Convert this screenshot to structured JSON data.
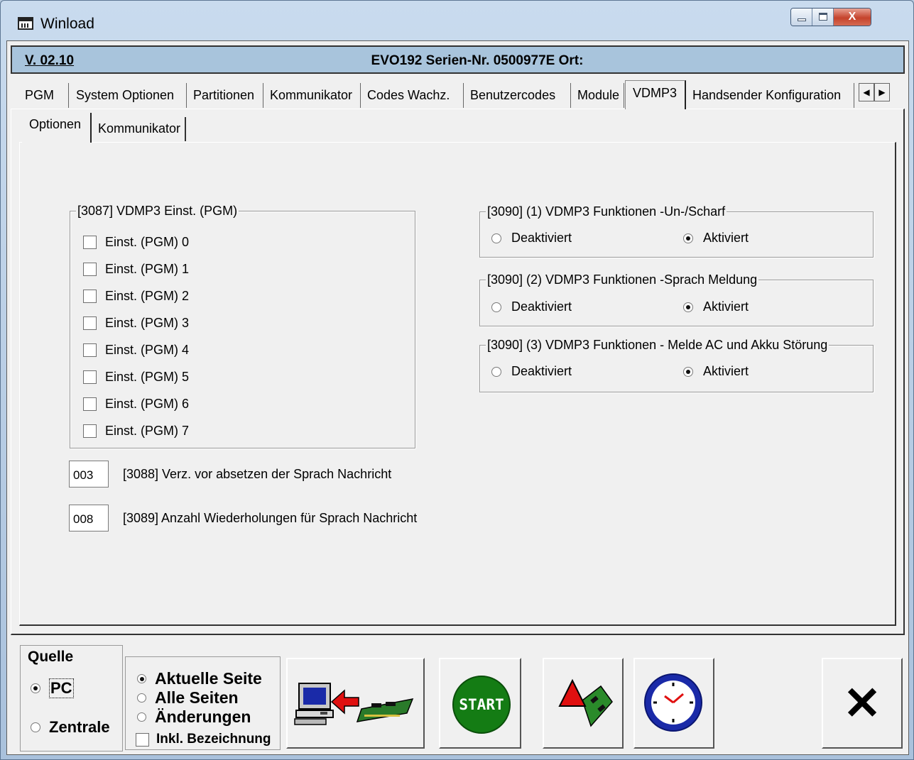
{
  "window": {
    "title": "Winload",
    "icons": {
      "app": "winload-app-icon",
      "minimize": "minimize-icon",
      "maximize": "maximize-icon",
      "close": "close-icon"
    },
    "close_glyph": "X"
  },
  "infobar": {
    "version": "V. 02.10",
    "device": "EVO192  Serien-Nr. 0500977E Ort:"
  },
  "tabs": [
    {
      "label": "PGM"
    },
    {
      "label": "System Optionen"
    },
    {
      "label": "Partitionen"
    },
    {
      "label": "Kommunikator"
    },
    {
      "label": "Codes Wachz."
    },
    {
      "label": "Benutzercodes"
    },
    {
      "label": "Module"
    },
    {
      "label": "VDMP3",
      "active": true
    },
    {
      "label": "Handsender Konfiguration"
    }
  ],
  "tab_scroll": {
    "left": "◀",
    "right": "▶"
  },
  "subtabs": [
    {
      "label": "Optionen",
      "active": true
    },
    {
      "label": "Kommunikator"
    }
  ],
  "pgm_group": {
    "title": "[3087]  VDMP3 Einst. (PGM)",
    "items": [
      {
        "label": "Einst. (PGM) 0",
        "checked": false
      },
      {
        "label": "Einst. (PGM) 1",
        "checked": false
      },
      {
        "label": "Einst. (PGM) 2",
        "checked": false
      },
      {
        "label": "Einst. (PGM) 3",
        "checked": false
      },
      {
        "label": "Einst. (PGM) 4",
        "checked": false
      },
      {
        "label": "Einst. (PGM) 5",
        "checked": false
      },
      {
        "label": "Einst. (PGM) 6",
        "checked": false
      },
      {
        "label": "Einst. (PGM) 7",
        "checked": false
      }
    ]
  },
  "fields": [
    {
      "value": "003",
      "label": "[3088] Verz. vor absetzen der Sprach Nachricht"
    },
    {
      "value": "008",
      "label": "[3089] Anzahl Wiederholungen für Sprach Nachricht"
    }
  ],
  "function_groups": [
    {
      "title": "[3090] (1)  VDMP3 Funktionen -Un-/Scharf",
      "off_label": "Deaktiviert",
      "on_label": "Aktiviert",
      "selected": "Aktiviert"
    },
    {
      "title": "[3090] (2)  VDMP3 Funktionen -Sprach Meldung",
      "off_label": "Deaktiviert",
      "on_label": "Aktiviert",
      "selected": "Aktiviert"
    },
    {
      "title": "[3090] (3)  VDMP3 Funktionen - Melde AC und Akku Störung",
      "off_label": "Deaktiviert",
      "on_label": "Aktiviert",
      "selected": "Aktiviert"
    }
  ],
  "bottom": {
    "quelle": {
      "title": "Quelle",
      "pc": "PC",
      "zentrale": "Zentrale",
      "selected": "PC"
    },
    "pages": {
      "options": [
        "Aktuelle Seite",
        "Alle Seiten",
        "Änderungen"
      ],
      "selected": "Aktuelle Seite",
      "include_label": "Inkl. Bezeichnung",
      "include_checked": false
    },
    "buttons": [
      {
        "name": "upload-to-panel-button",
        "icon": "pc-to-panel-icon"
      },
      {
        "name": "start-button",
        "icon": "start-icon",
        "label": "START"
      },
      {
        "name": "panel-alarm-button",
        "icon": "panel-warning-icon"
      },
      {
        "name": "clock-button",
        "icon": "clock-icon"
      },
      {
        "name": "exit-button",
        "icon": "close-x-icon",
        "label": "✕"
      }
    ]
  },
  "colors": {
    "infobar": "#a8c4dc",
    "start_green": "#147c14",
    "alert_red": "#e01010",
    "clock_blue": "#1a2aa8"
  }
}
